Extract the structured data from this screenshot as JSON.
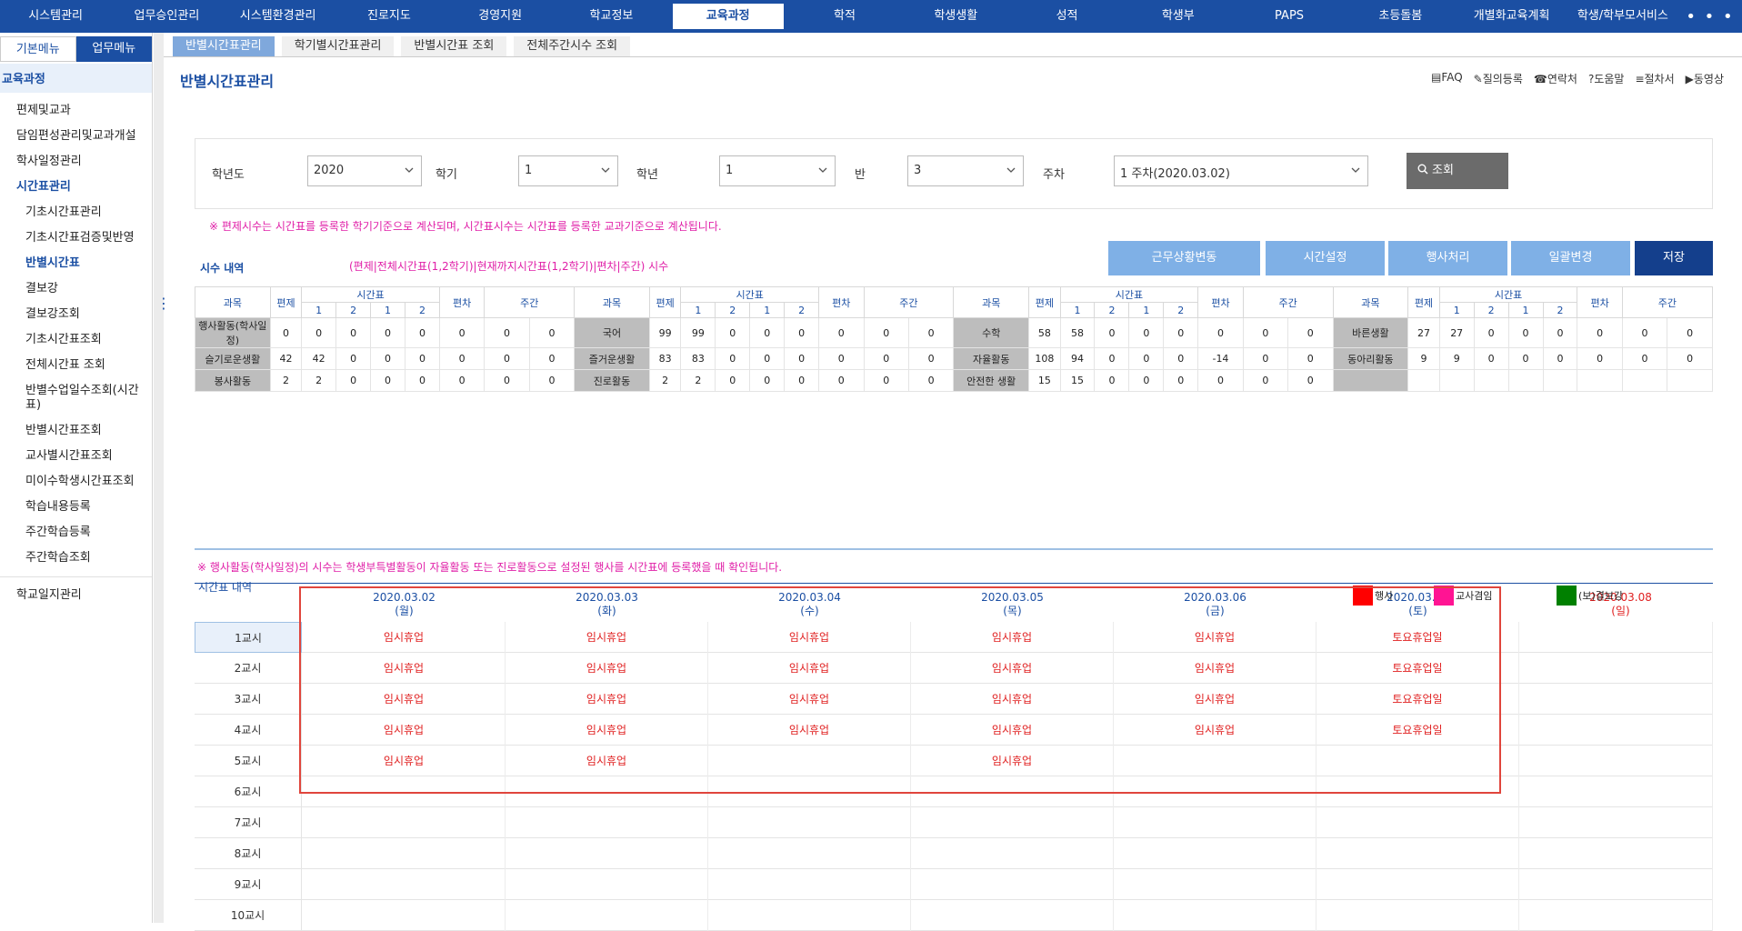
{
  "topnav": {
    "items": [
      "시스템관리",
      "업무승인관리",
      "시스템환경관리",
      "진로지도",
      "경영지원",
      "학교정보",
      "교육과정",
      "학적",
      "학생생활",
      "성적",
      "학생부",
      "PAPS",
      "초등돌봄",
      "개별화교육계획",
      "학생/학부모서비스"
    ],
    "active_index": 6,
    "more": "• • •"
  },
  "sidebar": {
    "tab_basic": "기본메뉴",
    "tab_work": "업무메뉴",
    "section": "교육과정",
    "items": [
      {
        "level": 1,
        "label": "편제및교과"
      },
      {
        "level": 1,
        "label": "담임편성관리및교과개설"
      },
      {
        "level": 1,
        "label": "학사일정관리"
      },
      {
        "level": 1,
        "label": "시간표관리",
        "active": true
      },
      {
        "level": 2,
        "label": "기초시간표관리"
      },
      {
        "level": 2,
        "label": "기초시간표검증및반영"
      },
      {
        "level": 2,
        "label": "반별시간표",
        "active": true
      },
      {
        "level": 2,
        "label": "결보강"
      },
      {
        "level": 2,
        "label": "결보강조회"
      },
      {
        "level": 2,
        "label": "기초시간표조회"
      },
      {
        "level": 2,
        "label": "전체시간표 조회"
      },
      {
        "level": 2,
        "label": "반별수업일수조회(시간표)",
        "wrap": true
      },
      {
        "level": 2,
        "label": "반별시간표조회"
      },
      {
        "level": 2,
        "label": "교사별시간표조회"
      },
      {
        "level": 2,
        "label": "미이수학생시간표조회"
      },
      {
        "level": 2,
        "label": "학습내용등록"
      },
      {
        "level": 2,
        "label": "주간학습등록"
      },
      {
        "level": 2,
        "label": "주간학습조회"
      }
    ],
    "last_item": "학교일지관리"
  },
  "subtabs": [
    "반별시간표관리",
    "학기별시간표관리",
    "반별시간표 조회",
    "전체주간시수 조회"
  ],
  "page_title": "반별시간표관리",
  "helplinks": [
    "FAQ",
    "질의등록",
    "연락처",
    "도움말",
    "절차서",
    "동영상"
  ],
  "search": {
    "year_label": "학년도",
    "year_value": "2020",
    "semester_label": "학기",
    "semester_value": "1",
    "grade_label": "학년",
    "grade_value": "1",
    "class_label": "반",
    "class_value": "3",
    "week_label": "주차",
    "week_value": "1 주차(2020.03.02)",
    "button": "조회"
  },
  "notice1": "※ 편제시수는 시간표를 등록한 학기기준으로 계산되며, 시간표시수는 시간표를 등록한 교과기준으로 계산됩니다.",
  "actions": [
    "근무상황변동",
    "시간설정",
    "행사처리",
    "일괄변경",
    "저장"
  ],
  "hours_section": {
    "label": "시수 내역",
    "formula": "(편제|전체시간표(1,2학기)|현재까지시간표(1,2학기)|편차|주간) 시수",
    "head": {
      "subject": "과목",
      "plan": "편제",
      "timetable": "시간표",
      "dev": "편차",
      "weekly": "주간",
      "nums": [
        "1",
        "2",
        "1",
        "2"
      ]
    },
    "rows": [
      [
        {
          "subj": "행사활동(학사일정)",
          "v": [
            "0",
            "0",
            "0",
            "0",
            "0",
            "0",
            "0",
            "0"
          ]
        },
        {
          "subj": "국어",
          "v": [
            "99",
            "99",
            "0",
            "0",
            "0",
            "0",
            "0",
            "0"
          ]
        },
        {
          "subj": "수학",
          "v": [
            "58",
            "58",
            "0",
            "0",
            "0",
            "0",
            "0",
            "0"
          ]
        },
        {
          "subj": "바른생활",
          "v": [
            "27",
            "27",
            "0",
            "0",
            "0",
            "0",
            "0",
            "0"
          ]
        }
      ],
      [
        {
          "subj": "슬기로운생활",
          "v": [
            "42",
            "42",
            "0",
            "0",
            "0",
            "0",
            "0",
            "0"
          ]
        },
        {
          "subj": "즐거운생활",
          "v": [
            "83",
            "83",
            "0",
            "0",
            "0",
            "0",
            "0",
            "0"
          ]
        },
        {
          "subj": "자율활동",
          "v": [
            "108",
            "94",
            "0",
            "0",
            "0",
            "-14",
            "0",
            "0"
          ]
        },
        {
          "subj": "동아리활동",
          "v": [
            "9",
            "9",
            "0",
            "0",
            "0",
            "0",
            "0",
            "0"
          ]
        }
      ],
      [
        {
          "subj": "봉사활동",
          "v": [
            "2",
            "2",
            "0",
            "0",
            "0",
            "0",
            "0",
            "0"
          ]
        },
        {
          "subj": "진로활동",
          "v": [
            "2",
            "2",
            "0",
            "0",
            "0",
            "0",
            "0",
            "0"
          ]
        },
        {
          "subj": "안전한 생활",
          "v": [
            "15",
            "15",
            "0",
            "0",
            "0",
            "0",
            "0",
            "0"
          ]
        },
        {
          "subj": "",
          "v": [
            "",
            "",
            "",
            "",
            "",
            "",
            "",
            ""
          ]
        }
      ]
    ]
  },
  "notice2": "※ 행사활동(학사일정)의 시수는 학생부특별활동이 자율활동 또는 진로활동으로 설정된 행사를 시간표에 등록했을 때 확인됩니다.",
  "timetable": {
    "label": "시간표 내역",
    "days": [
      {
        "date": "2020.03.02",
        "wd": "(월)"
      },
      {
        "date": "2020.03.03",
        "wd": "(화)"
      },
      {
        "date": "2020.03.04",
        "wd": "(수)"
      },
      {
        "date": "2020.03.05",
        "wd": "(목)"
      },
      {
        "date": "2020.03.06",
        "wd": "(금)"
      },
      {
        "date": "2020.03.07",
        "wd": "(토)"
      },
      {
        "date": "2020.03.08",
        "wd": "(일)"
      }
    ],
    "legend": [
      {
        "label": "행사",
        "color": "#ff0000"
      },
      {
        "label": "교사겸임",
        "color": "#ff1493"
      },
      {
        "label": "(보)결보강",
        "color": "#008000"
      }
    ],
    "periods": [
      "1교시",
      "2교시",
      "3교시",
      "4교시",
      "5교시",
      "6교시",
      "7교시",
      "8교시",
      "9교시",
      "10교시"
    ],
    "cells": [
      [
        "임시휴업",
        "임시휴업",
        "임시휴업",
        "임시휴업",
        "임시휴업",
        "토요휴업일",
        ""
      ],
      [
        "임시휴업",
        "임시휴업",
        "임시휴업",
        "임시휴업",
        "임시휴업",
        "토요휴업일",
        ""
      ],
      [
        "임시휴업",
        "임시휴업",
        "임시휴업",
        "임시휴업",
        "임시휴업",
        "토요휴업일",
        ""
      ],
      [
        "임시휴업",
        "임시휴업",
        "임시휴업",
        "임시휴업",
        "임시휴업",
        "토요휴업일",
        ""
      ],
      [
        "임시휴업",
        "임시휴업",
        "",
        "임시휴업",
        "",
        "",
        ""
      ],
      [
        "",
        "",
        "",
        "",
        "",
        "",
        ""
      ],
      [
        "",
        "",
        "",
        "",
        "",
        "",
        ""
      ],
      [
        "",
        "",
        "",
        "",
        "",
        "",
        ""
      ],
      [
        "",
        "",
        "",
        "",
        "",
        "",
        ""
      ],
      [
        "",
        "",
        "",
        "",
        "",
        "",
        ""
      ]
    ]
  }
}
